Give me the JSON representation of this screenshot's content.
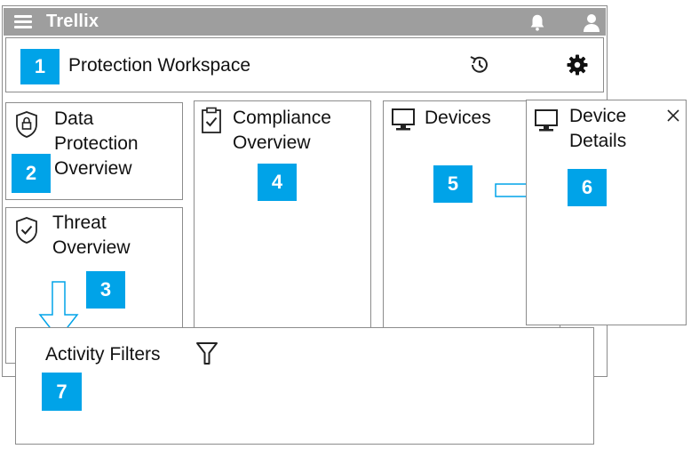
{
  "app": {
    "brand": "Trellix",
    "icons": [
      "menu-icon",
      "bell-icon",
      "user-icon",
      "history-icon",
      "gear-icon"
    ]
  },
  "header": {
    "badge": "1",
    "title": "Protection Workspace"
  },
  "panels": {
    "data_protection": {
      "badge": "2",
      "title_line1": "Data",
      "title_line2": "Protection",
      "title_line3": "Overview",
      "icon": "lock-shield-icon"
    },
    "threat": {
      "badge": "3",
      "title_line1": "Threat",
      "title_line2": "Overview",
      "icon": "check-shield-icon"
    },
    "compliance": {
      "badge": "4",
      "title_line1": "Compliance",
      "title_line2": "Overview",
      "icon": "clipboard-check-icon"
    },
    "devices": {
      "badge": "5",
      "title": "Devices",
      "icon": "monitor-icon"
    },
    "device_details": {
      "badge": "6",
      "title_line1": "Device",
      "title_line2": "Details",
      "icon": "monitor-icon",
      "close_icon": "close-icon"
    },
    "activity_filters": {
      "badge": "7",
      "title": "Activity Filters",
      "icon": "filter-icon"
    }
  },
  "colors": {
    "badge": "#00a3e8",
    "topbar": "#9e9e9e",
    "border": "#8c8c8c",
    "arrow": "#00a3e8"
  }
}
